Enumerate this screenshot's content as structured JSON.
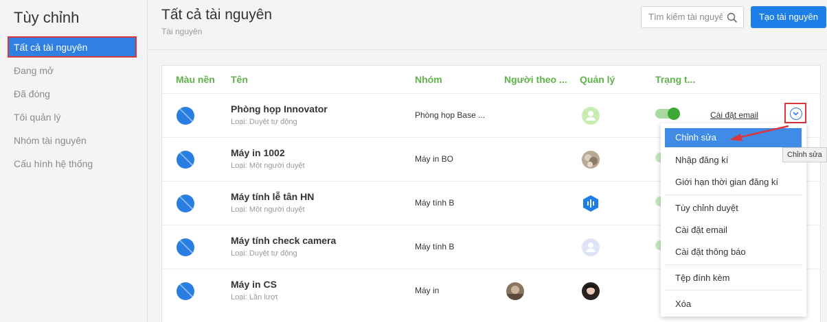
{
  "sidebar": {
    "title": "Tùy chỉnh",
    "active_item": "Tất cả tài nguyên",
    "items": [
      "Đang mở",
      "Đã đóng",
      "Tôi quản lý",
      "Nhóm tài nguyên",
      "Cấu hình hệ thống"
    ]
  },
  "header": {
    "title": "Tất cả tài nguyên",
    "breadcrumb": "Tài nguyên",
    "search_placeholder": "Tìm kiếm tài nguyên",
    "create_label": "Tạo tài nguyên"
  },
  "table": {
    "columns": [
      "Màu nền",
      "Tên",
      "Nhóm",
      "Người theo ...",
      "Quản lý",
      "Trạng t..."
    ],
    "rows": [
      {
        "name": "Phòng họp Innovator",
        "type": "Loại: Duyệt tự động",
        "group": "Phòng họp Base ...",
        "action_link": "Cài đặt email"
      },
      {
        "name": "Máy in 1002",
        "type": "Loại: Một người duyệt",
        "group": "Máy in BO"
      },
      {
        "name": "Máy tính lễ tân HN",
        "type": "Loại: Một người duyệt",
        "group": "Máy tính B"
      },
      {
        "name": "Máy tính check camera",
        "type": "Loại: Duyệt tự động",
        "group": "Máy tính B"
      },
      {
        "name": "Máy in CS",
        "type": "Loại: Lần lượt",
        "group": "Máy in"
      }
    ]
  },
  "dropdown": {
    "items": [
      "Chỉnh sửa",
      "Nhập đăng kí",
      "Giới hạn thời gian đăng kí",
      "Tùy chỉnh duyệt",
      "Cài đặt email",
      "Cài đặt thông báo",
      "Tệp đính kèm",
      "Xóa"
    ]
  },
  "tooltip": "Chỉnh sửa",
  "colors": {
    "accent": "#2a7de1",
    "header_green": "#5db24a",
    "highlight_red": "#d9363e"
  }
}
